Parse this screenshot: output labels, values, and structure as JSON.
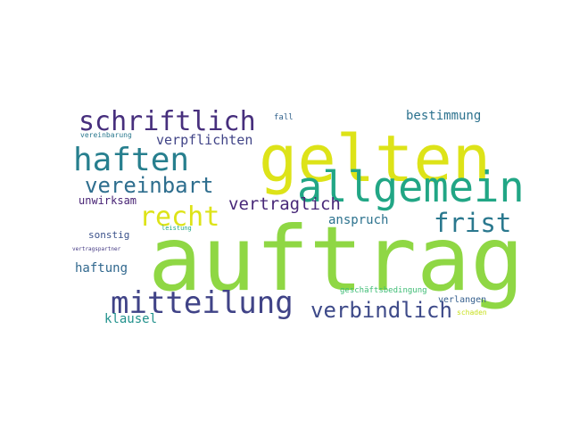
{
  "word_cloud": {
    "words": [
      {
        "id": "auftrag",
        "text": "auftrag",
        "color": "#8fd744"
      },
      {
        "id": "gelten",
        "text": "gelten",
        "color": "#dde318"
      },
      {
        "id": "allgemein",
        "text": "allgemein",
        "color": "#21a685"
      },
      {
        "id": "mitteilung",
        "text": "mitteilung",
        "color": "#404387"
      },
      {
        "id": "schriftlich",
        "text": "schriftlich",
        "color": "#472f7d"
      },
      {
        "id": "haften",
        "text": "haften",
        "color": "#277f8e"
      },
      {
        "id": "recht",
        "text": "recht",
        "color": "#dde318"
      },
      {
        "id": "vereinbart",
        "text": "vereinbart",
        "color": "#2e6e8e"
      },
      {
        "id": "frist",
        "text": "frist",
        "color": "#2a788e"
      },
      {
        "id": "verbindlich",
        "text": "verbindlich",
        "color": "#3e4a89"
      },
      {
        "id": "vertraglich",
        "text": "vertraglich",
        "color": "#482878"
      },
      {
        "id": "verpflichten",
        "text": "verpflichten",
        "color": "#414487"
      },
      {
        "id": "bestimmung",
        "text": "bestimmung",
        "color": "#2c728e"
      },
      {
        "id": "anspruch",
        "text": "anspruch",
        "color": "#2c728e"
      },
      {
        "id": "haftung",
        "text": "haftung",
        "color": "#31688e"
      },
      {
        "id": "klausel",
        "text": "klausel",
        "color": "#21918c"
      },
      {
        "id": "unwirksam",
        "text": "unwirksam",
        "color": "#482475"
      },
      {
        "id": "sonstig",
        "text": "sonstig",
        "color": "#3b528b"
      },
      {
        "id": "verlangen",
        "text": "verlangen",
        "color": "#355f8d"
      },
      {
        "id": "fall",
        "text": "fall",
        "color": "#33638d"
      },
      {
        "id": "vereinbarung",
        "text": "vereinbarung",
        "color": "#2a788e"
      },
      {
        "id": "geschaeftsbedingung",
        "text": "geschäftsbedingung",
        "color": "#3dbc74"
      },
      {
        "id": "leistung",
        "text": "leistung",
        "color": "#21a685"
      },
      {
        "id": "schaden",
        "text": "schaden",
        "color": "#c8e020"
      },
      {
        "id": "vertragspartner",
        "text": "vertragspartner",
        "color": "#443983"
      }
    ]
  }
}
